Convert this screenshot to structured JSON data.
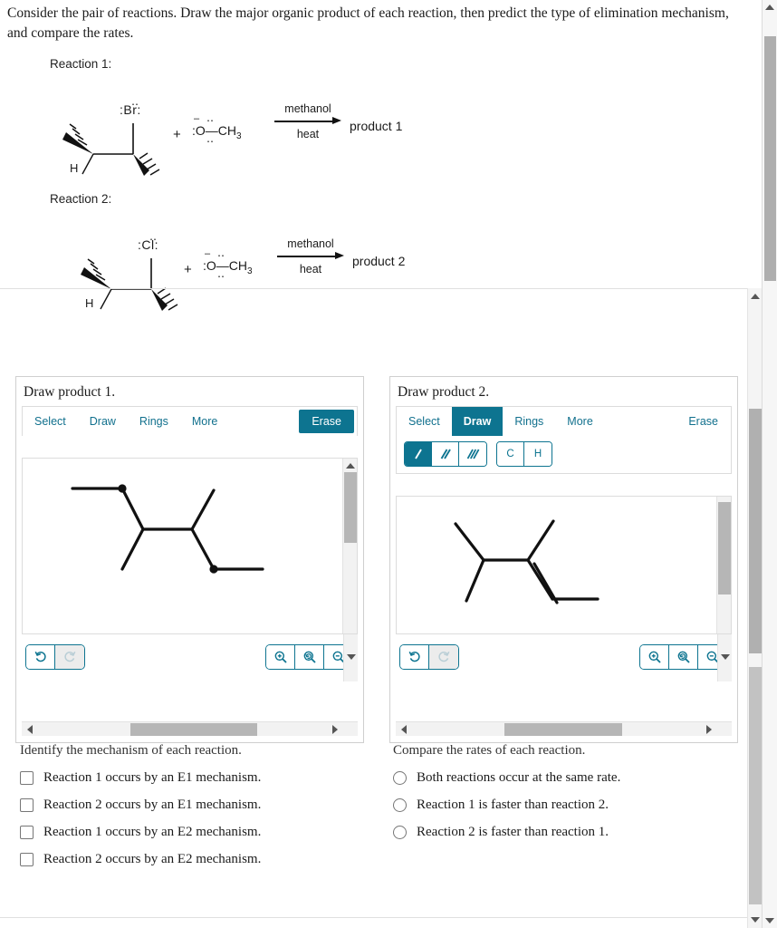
{
  "prompt": "Consider the pair of reactions. Draw the major organic product of each reaction, then predict the type of elimination mechanism, and compare the rates.",
  "reactions": [
    {
      "label": "Reaction 1:",
      "halogen": "Br",
      "halogen_display": ":Br:",
      "hydrogen_label": "H",
      "plus": "+",
      "reagent_charge": "–",
      "reagent_o": "O",
      "reagent_methyl": "CH3",
      "condition_top": "methanol",
      "condition_bottom": "heat",
      "product": "product 1"
    },
    {
      "label": "Reaction 2:",
      "halogen": "Cl",
      "halogen_display": ":Cl:",
      "hydrogen_label": "H",
      "plus": "+",
      "reagent_charge": "–",
      "reagent_o": "O",
      "reagent_methyl": "CH3",
      "condition_top": "methanol",
      "condition_bottom": "heat",
      "product": "product 2"
    }
  ],
  "panels": [
    {
      "title": "Draw product 1.",
      "tabs": [
        {
          "label": "Select",
          "active": false
        },
        {
          "label": "Draw",
          "active": false
        },
        {
          "label": "Rings",
          "active": false
        },
        {
          "label": "More",
          "active": false
        }
      ],
      "erase_label": "Erase",
      "erase_active": true,
      "show_subtoolbar": false,
      "bond_tools": [],
      "atom_tools": [],
      "undo_label": "undo",
      "redo_label": "redo",
      "redo_disabled": true,
      "zoom_in_label": "zoom-in",
      "zoom_reset_label": "zoom-reset",
      "zoom_out_label": "zoom-out"
    },
    {
      "title": "Draw product 2.",
      "tabs": [
        {
          "label": "Select",
          "active": false
        },
        {
          "label": "Draw",
          "active": true
        },
        {
          "label": "Rings",
          "active": false
        },
        {
          "label": "More",
          "active": false
        }
      ],
      "erase_label": "Erase",
      "erase_active": false,
      "show_subtoolbar": true,
      "bond_tools": [
        {
          "name": "single-bond",
          "glyph": "/",
          "active": true
        },
        {
          "name": "double-bond",
          "glyph": "//",
          "active": false
        },
        {
          "name": "triple-bond",
          "glyph": "///",
          "active": false
        }
      ],
      "atom_tools": [
        {
          "name": "carbon",
          "label": "C"
        },
        {
          "name": "hydrogen",
          "label": "H"
        }
      ],
      "undo_label": "undo",
      "redo_label": "redo",
      "redo_disabled": true,
      "zoom_in_label": "zoom-in",
      "zoom_reset_label": "zoom-reset",
      "zoom_out_label": "zoom-out"
    }
  ],
  "mechanism_question": {
    "title": "Identify the mechanism of each reaction.",
    "options": [
      {
        "label": "Reaction 1 occurs by an E1 mechanism.",
        "checked": false
      },
      {
        "label": "Reaction 2 occurs by an E1 mechanism.",
        "checked": false
      },
      {
        "label": "Reaction 1 occurs by an E2 mechanism.",
        "checked": false
      },
      {
        "label": "Reaction 2 occurs by an E2 mechanism.",
        "checked": false
      }
    ]
  },
  "rate_question": {
    "title": "Compare the rates of each reaction.",
    "options": [
      {
        "label": "Both reactions occur at the same rate.",
        "selected": false
      },
      {
        "label": "Reaction 1 is faster than reaction 2.",
        "selected": false
      },
      {
        "label": "Reaction 2 is faster than reaction 1.",
        "selected": false
      }
    ]
  },
  "colors": {
    "accent": "#0d7490",
    "accent_text": "#11708d",
    "border": "#dcdcdc",
    "scrollbar_thumb": "#b6b6b6"
  }
}
